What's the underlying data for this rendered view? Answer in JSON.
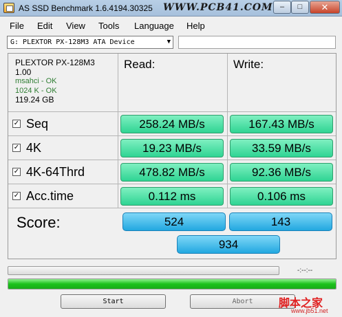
{
  "window": {
    "title": "AS SSD Benchmark 1.6.4194.30325",
    "watermark": "WWW.PCB41.COM",
    "minimize": "–",
    "maximize": "□",
    "close": "✕"
  },
  "menu": [
    "File",
    "Edit",
    "View",
    "Tools",
    "Language",
    "Help"
  ],
  "drive_selector": {
    "value": "G: PLEXTOR  PX-128M3 ATA Device",
    "arrow": "▼"
  },
  "drive_info": {
    "model": "PLEXTOR PX-128M3",
    "firmware": "1.00",
    "driver_status": "msahci - OK",
    "alignment_status": "1024 K - OK",
    "capacity": "119.24 GB"
  },
  "columns": {
    "read": "Read:",
    "write": "Write:"
  },
  "tests": [
    {
      "label": "Seq",
      "checked": true,
      "read": "258.24 MB/s",
      "write": "167.43 MB/s"
    },
    {
      "label": "4K",
      "checked": true,
      "read": "19.23 MB/s",
      "write": "33.59 MB/s"
    },
    {
      "label": "4K-64Thrd",
      "checked": true,
      "read": "478.82 MB/s",
      "write": "92.36 MB/s"
    },
    {
      "label": "Acc.time",
      "checked": true,
      "read": "0.112 ms",
      "write": "0.106 ms"
    }
  ],
  "score": {
    "label": "Score:",
    "read": "524",
    "write": "143",
    "total": "934"
  },
  "progress": {
    "time": "-:--:--",
    "overall_fraction": 1.0
  },
  "buttons": {
    "start": "Start",
    "abort": "Abort"
  },
  "site_watermark": {
    "name": "脚本之家",
    "url": "www.jb51.net"
  },
  "colors": {
    "result_green": "#2fd493",
    "score_blue": "#22a8e0",
    "progress_green": "#1bc21b"
  }
}
